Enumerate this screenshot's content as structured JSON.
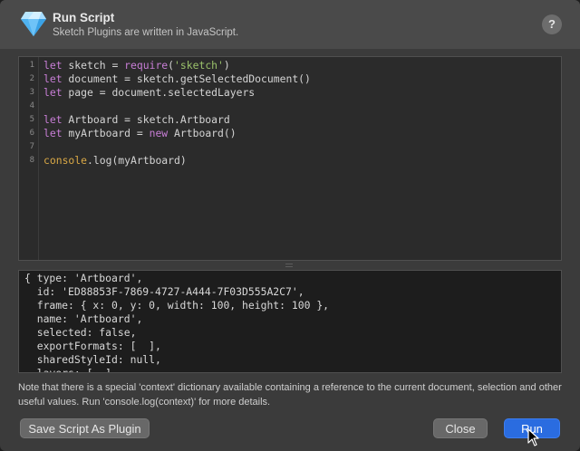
{
  "dialog": {
    "title": "Run Script",
    "subtitle": "Sketch Plugins are written in JavaScript.",
    "help_label": "?"
  },
  "editor": {
    "line_numbers": [
      "1",
      "2",
      "3",
      "4",
      "5",
      "6",
      "7",
      "8"
    ],
    "lines": [
      [
        {
          "t": "let",
          "k": "kw"
        },
        {
          "t": " sketch = "
        },
        {
          "t": "require",
          "k": "kw"
        },
        {
          "t": "("
        },
        {
          "t": "'sketch'",
          "k": "str"
        },
        {
          "t": ")"
        }
      ],
      [
        {
          "t": "let",
          "k": "kw"
        },
        {
          "t": " document = sketch.getSelectedDocument()"
        }
      ],
      [
        {
          "t": "let",
          "k": "kw"
        },
        {
          "t": " page = document.selectedLayers"
        }
      ],
      [],
      [
        {
          "t": "let",
          "k": "kw"
        },
        {
          "t": " Artboard = sketch.Artboard"
        }
      ],
      [
        {
          "t": "let",
          "k": "kw"
        },
        {
          "t": " myArtboard = "
        },
        {
          "t": "new",
          "k": "kw"
        },
        {
          "t": " Artboard()"
        }
      ],
      [],
      [
        {
          "t": "console",
          "k": "con"
        },
        {
          "t": ".log(myArtboard)"
        }
      ]
    ]
  },
  "output": {
    "lines": [
      "{ type: 'Artboard',",
      "  id: 'ED88853F-7869-4727-A444-7F03D555A2C7',",
      "  frame: { x: 0, y: 0, width: 100, height: 100 },",
      "  name: 'Artboard',",
      "  selected: false,",
      "  exportFormats: [  ],",
      "  sharedStyleId: null,",
      "  layers: [  ],"
    ]
  },
  "note": "Note that there is a special 'context' dictionary available containing a reference to the current document, selection and other useful values. Run 'console.log(context)' for more details.",
  "buttons": {
    "save_plugin": "Save Script As Plugin",
    "close": "Close",
    "run": "Run"
  },
  "colors": {
    "keyword": "#c87ed6",
    "console": "#d9a846",
    "string": "#9bc26b",
    "primary_button": "#2a6ce0"
  },
  "icons": {
    "app": "sketch-diamond-icon",
    "help": "help-icon",
    "cursor": "mouse-pointer-icon"
  }
}
